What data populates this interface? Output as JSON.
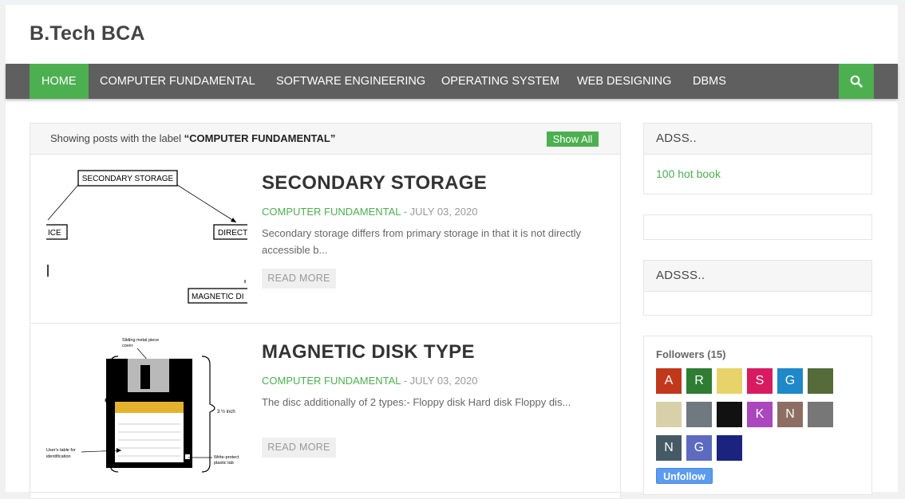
{
  "site": {
    "title": "B.Tech BCA"
  },
  "nav": {
    "items": [
      {
        "label": "HOME",
        "active": true
      },
      {
        "label": "COMPUTER FUNDAMENTAL"
      },
      {
        "label": "SOFTWARE ENGINEERING"
      },
      {
        "label": "OPERATING SYSTEM"
      },
      {
        "label": "WEB DESIGNING"
      },
      {
        "label": "DBMS"
      }
    ],
    "search_icon": "search-icon"
  },
  "label_bar": {
    "prefix": "Showing posts with the label",
    "label": "“COMPUTER FUNDAMENTAL”",
    "show_all": "Show All"
  },
  "posts": [
    {
      "title": "SECONDARY STORAGE",
      "category": "COMPUTER FUNDAMENTAL",
      "date": "- JULY 03, 2020",
      "snippet": "Secondary storage  differs from primary storage in that it is not directly accessible b...",
      "read_more": "READ MORE",
      "thumb": {
        "box_top": "SECONDARY STORAGE",
        "box_left": "ICE",
        "box_right": "DIRECT",
        "box_bottom": "MAGNETIC DI"
      }
    },
    {
      "title": "MAGNETIC DISK TYPE",
      "category": "COMPUTER FUNDAMENTAL",
      "date": "- JULY 03, 2020",
      "snippet": "The  disc  additionally  of  2  types:- Floppy disk Hard disk Floppy dis...",
      "read_more": "READ MORE",
      "thumb": {
        "shutter_label": "Sliding metal piece",
        "shutter_label2": "cover",
        "size_label": "3 ½ inch",
        "left_label": "User's table for",
        "left_label2": "identification",
        "protect_label": "Write-protect",
        "protect_label2": "plastic tab"
      }
    }
  ],
  "sidebar": {
    "adss": {
      "title": "ADSS..",
      "link": "100 hot book"
    },
    "adsss": {
      "title": "ADSSS.."
    },
    "followers": {
      "title": "Followers (15)",
      "unfollow": "Unfollow",
      "avatars": [
        {
          "letter": "A",
          "color": "#c0391b"
        },
        {
          "letter": "R",
          "color": "#2e7d32"
        },
        {
          "letter": "",
          "color": "#e8d36a"
        },
        {
          "letter": "S",
          "color": "#d81b60"
        },
        {
          "letter": "G",
          "color": "#1e88c8"
        },
        {
          "letter": "",
          "color": "#556b3a"
        },
        {
          "letter": "",
          "color": "#d8d0a8"
        },
        {
          "letter": "",
          "color": "#707880"
        },
        {
          "letter": "",
          "color": "#111111"
        },
        {
          "letter": "K",
          "color": "#ab47bc"
        },
        {
          "letter": "N",
          "color": "#8d6e63"
        },
        {
          "letter": "",
          "color": "#777777"
        },
        {
          "letter": "N",
          "color": "#455a64"
        },
        {
          "letter": "G",
          "color": "#5c6bc0"
        },
        {
          "letter": "",
          "color": "#1a237e"
        }
      ]
    }
  }
}
